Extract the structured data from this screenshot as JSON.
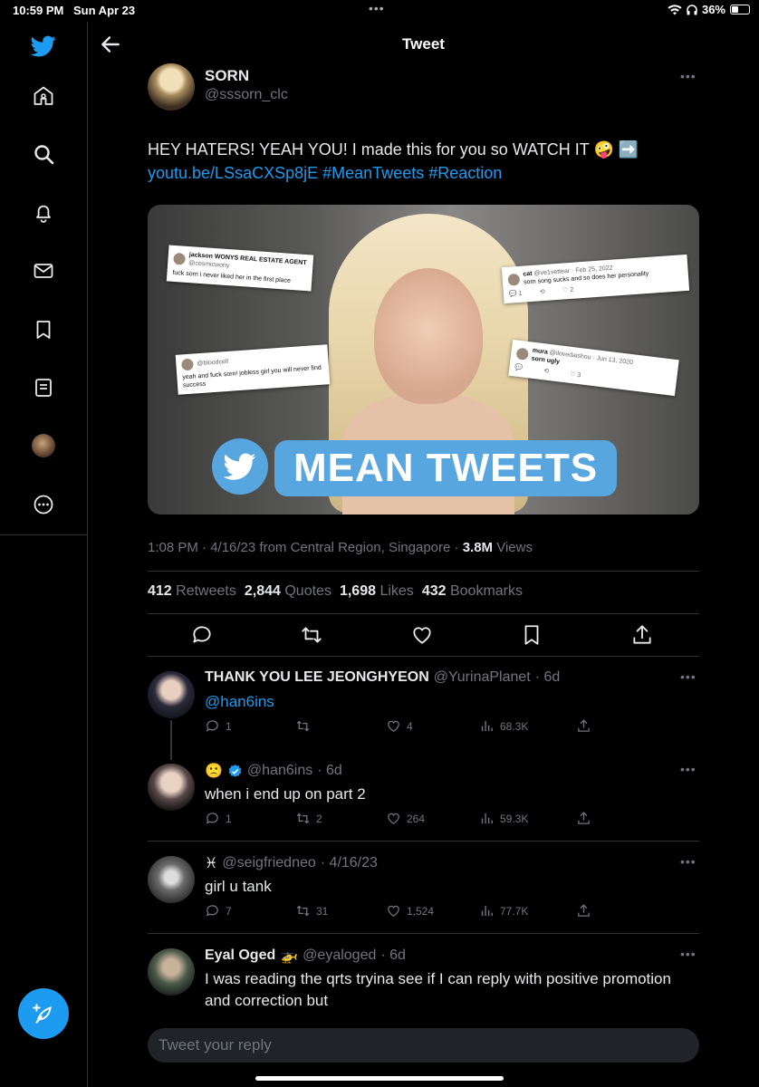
{
  "status_bar": {
    "time": "10:59 PM",
    "date": "Sun Apr 23",
    "battery": "36%"
  },
  "header": {
    "title": "Tweet"
  },
  "tweet": {
    "author_name": "SORN",
    "author_handle": "@sssorn_clc",
    "text_line1": "HEY HATERS! YEAH YOU! I made this for you so WATCH IT 🤪 ➡️",
    "link": "youtu.be/LSsaCXSp8jE",
    "hashtag1": "#MeanTweets",
    "hashtag2": "#Reaction",
    "media": {
      "banner_text": "MEAN TWEETS",
      "cards": [
        {
          "name": "jackson WONYS REAL ESTATE AGENT",
          "handle": "@cosmicwony",
          "text": "fuck sorn i never liked her in the first place"
        },
        {
          "name": "cat",
          "handle": "@ve1vettear · Feb 25, 2022",
          "text": "sorn song sucks and so does her personality",
          "replies": "1",
          "likes": "2"
        },
        {
          "name": "",
          "handle": "@bloodcell",
          "text": "yeah and fuck sorn! jobless girl you will never find success"
        },
        {
          "name": "mura",
          "handle": "@ilovedaishou · Jun 13, 2020",
          "text": "sorn ugly",
          "likes": "3"
        }
      ]
    },
    "meta_time": "1:08 PM · 4/16/23 from Central Region, Singapore · ",
    "views_count": "3.8M",
    "views_label": " Views",
    "stats": {
      "retweets": "412",
      "retweets_label": "Retweets",
      "quotes": "2,844",
      "quotes_label": "Quotes",
      "likes": "1,698",
      "likes_label": "Likes",
      "bookmarks": "432",
      "bookmarks_label": "Bookmarks"
    }
  },
  "replies": [
    {
      "name": "THANK YOU LEE JEONGHYEON",
      "handle": "@YurinaPlanet",
      "time": "· 6d",
      "text": "@han6ins",
      "text_is_link": true,
      "reply_count": "1",
      "retweet_count": "",
      "like_count": "4",
      "view_count": "68.3K"
    },
    {
      "name": "🙁",
      "handle": "@han6ins",
      "time": "· 6d",
      "text": "when i end up on part 2",
      "verified": true,
      "reply_count": "1",
      "retweet_count": "2",
      "like_count": "264",
      "view_count": "59.3K"
    },
    {
      "name": "♓",
      "handle": "@seigfriedneo",
      "time": "· 4/16/23",
      "text": "girl u tank",
      "reply_count": "7",
      "retweet_count": "31",
      "like_count": "1,524",
      "view_count": "77.7K"
    },
    {
      "name": "Eyal Oged",
      "emoji": "🚁",
      "handle": "@eyaloged",
      "time": "· 6d",
      "text": "I was reading the qrts tryina see if I can reply with positive promotion and correction but"
    }
  ],
  "reply_box": {
    "placeholder": "Tweet your reply"
  },
  "icons": [
    "twitter-logo-icon",
    "home-icon",
    "search-icon",
    "bell-icon",
    "mail-icon",
    "bookmark-icon",
    "list-icon",
    "profile-avatar",
    "more-circle-icon",
    "compose-icon"
  ],
  "colors": {
    "accent": "#1d9bf0",
    "background": "#000000",
    "muted": "#71767b"
  }
}
